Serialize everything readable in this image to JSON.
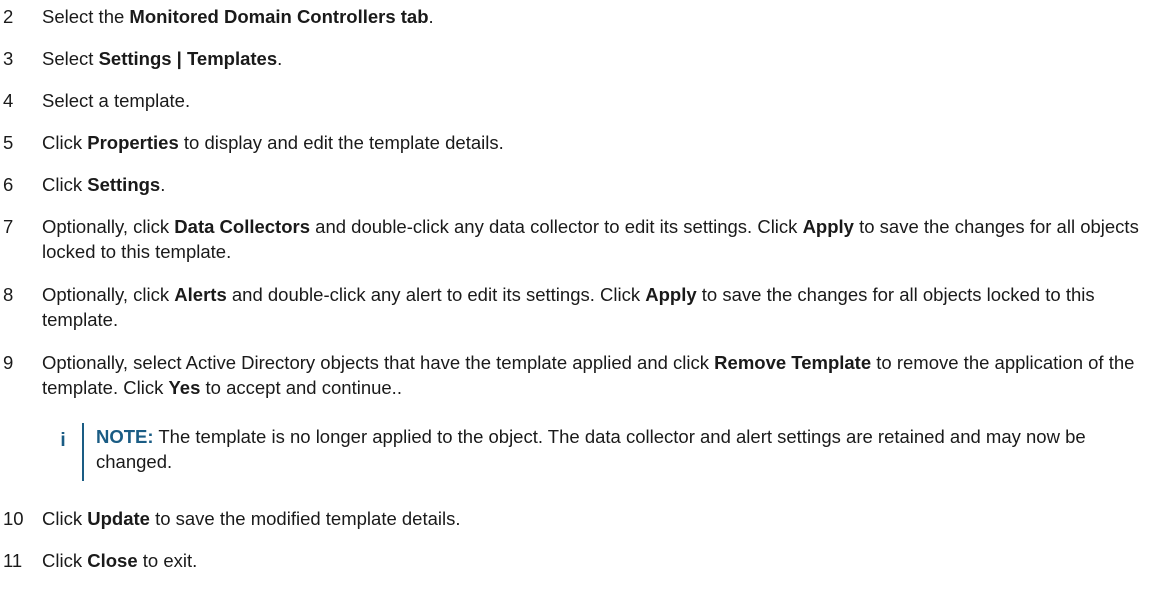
{
  "steps": [
    {
      "number": "2",
      "parts": [
        {
          "text": "Select the ",
          "bold": false
        },
        {
          "text": "Monitored Domain Controllers tab",
          "bold": true
        },
        {
          "text": ".",
          "bold": false
        }
      ]
    },
    {
      "number": "3",
      "parts": [
        {
          "text": "Select ",
          "bold": false
        },
        {
          "text": "Settings | Templates",
          "bold": true
        },
        {
          "text": ".",
          "bold": false
        }
      ]
    },
    {
      "number": "4",
      "parts": [
        {
          "text": "Select a template.",
          "bold": false
        }
      ]
    },
    {
      "number": "5",
      "parts": [
        {
          "text": "Click ",
          "bold": false
        },
        {
          "text": "Properties",
          "bold": true
        },
        {
          "text": " to display and edit the template details.",
          "bold": false
        }
      ]
    },
    {
      "number": "6",
      "parts": [
        {
          "text": "Click ",
          "bold": false
        },
        {
          "text": "Settings",
          "bold": true
        },
        {
          "text": ".",
          "bold": false
        }
      ]
    },
    {
      "number": "7",
      "parts": [
        {
          "text": "Optionally, click ",
          "bold": false
        },
        {
          "text": "Data Collectors",
          "bold": true
        },
        {
          "text": " and double-click any data collector to edit its settings. Click ",
          "bold": false
        },
        {
          "text": "Apply",
          "bold": true
        },
        {
          "text": " to save the changes for all objects locked to this template.",
          "bold": false
        }
      ]
    },
    {
      "number": "8",
      "parts": [
        {
          "text": "Optionally, click ",
          "bold": false
        },
        {
          "text": "Alerts",
          "bold": true
        },
        {
          "text": " and double-click any alert to edit its settings. Click ",
          "bold": false
        },
        {
          "text": "Apply",
          "bold": true
        },
        {
          "text": " to save the changes for all objects locked to this template.",
          "bold": false
        }
      ]
    },
    {
      "number": "9",
      "parts": [
        {
          "text": "Optionally, select Active Directory objects that have the template applied and click ",
          "bold": false
        },
        {
          "text": "Remove Template",
          "bold": true
        },
        {
          "text": " to remove the application of the template. Click ",
          "bold": false
        },
        {
          "text": "Yes",
          "bold": true
        },
        {
          "text": " to accept and continue..",
          "bold": false
        }
      ]
    },
    {
      "number": "10",
      "parts": [
        {
          "text": "Click ",
          "bold": false
        },
        {
          "text": "Update",
          "bold": true
        },
        {
          "text": " to save the modified template details.",
          "bold": false
        }
      ]
    },
    {
      "number": "11",
      "parts": [
        {
          "text": "Click ",
          "bold": false
        },
        {
          "text": "Close",
          "bold": true
        },
        {
          "text": " to exit.",
          "bold": false
        }
      ]
    }
  ],
  "note": {
    "icon": "info-icon",
    "icon_glyph": "i",
    "label": "NOTE:",
    "text": " The template is no longer applied to the object. The data collector and alert settings are retained and may now be changed.",
    "accent_color": "#1a5c84"
  }
}
